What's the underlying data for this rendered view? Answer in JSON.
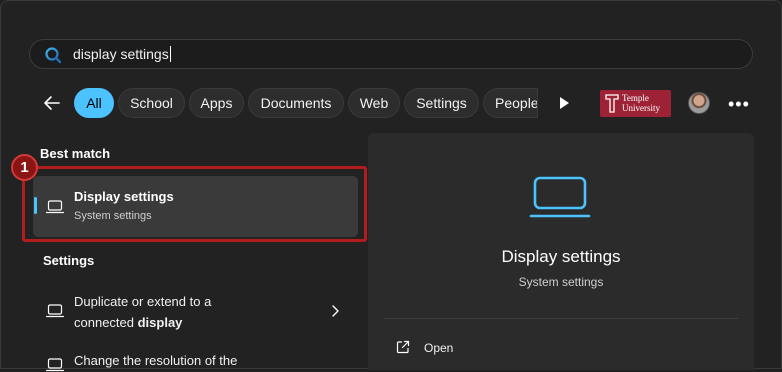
{
  "search": {
    "query": "display settings"
  },
  "filters": {
    "chips": [
      {
        "label": "All",
        "active": true
      },
      {
        "label": "School"
      },
      {
        "label": "Apps"
      },
      {
        "label": "Documents"
      },
      {
        "label": "Web"
      },
      {
        "label": "Settings"
      },
      {
        "label": "People"
      }
    ],
    "org_logo": {
      "line1": "Temple",
      "line2": "University"
    }
  },
  "results": {
    "best_match_heading": "Best match",
    "annotation_number": "1",
    "best_match": {
      "title": "Display settings",
      "subtitle": "System settings"
    },
    "settings_heading": "Settings",
    "settings_items": [
      {
        "line1": "Duplicate or extend to a",
        "line2_prefix": "connected ",
        "line2_bold": "display"
      },
      {
        "line1": "Change the resolution of the"
      }
    ]
  },
  "preview": {
    "title": "Display settings",
    "subtitle": "System settings",
    "actions": [
      {
        "label": "Open",
        "icon": "open-external-icon"
      }
    ]
  },
  "colors": {
    "accent": "#4cc2ff",
    "highlight": "#b21c1c",
    "logo_bg": "#9d2235"
  }
}
